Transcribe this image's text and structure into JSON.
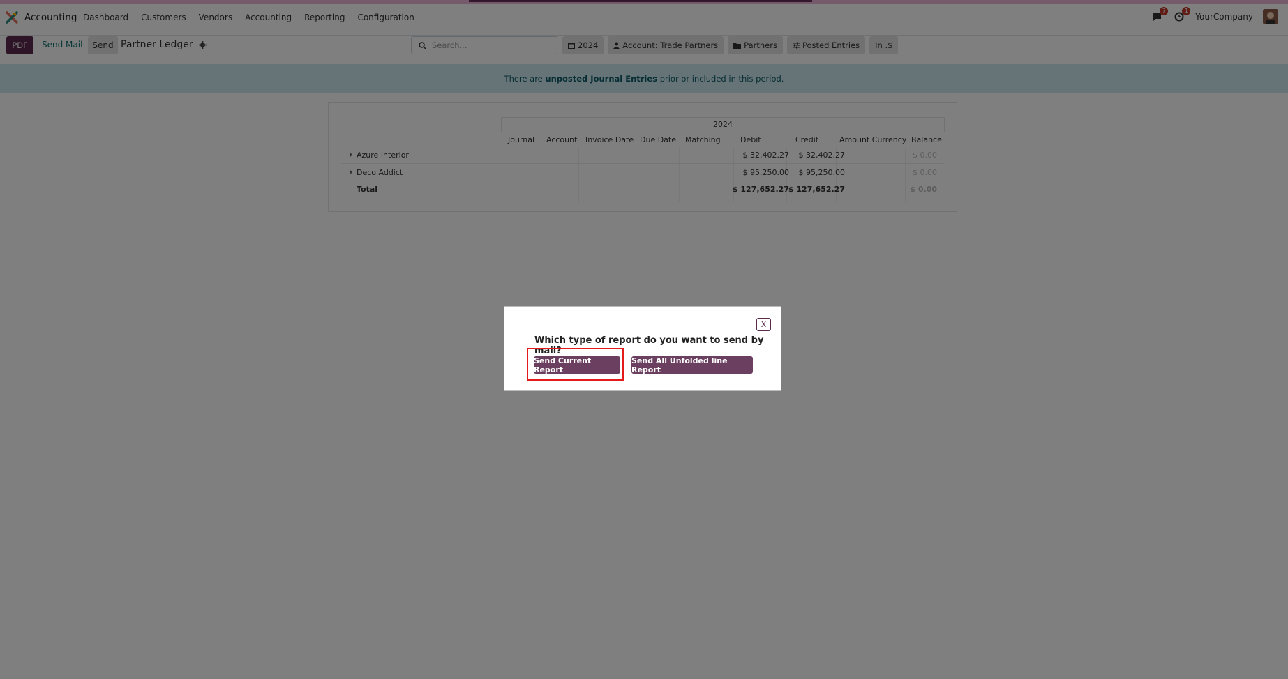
{
  "topbar": {
    "app_name": "Accounting",
    "menu": [
      "Dashboard",
      "Customers",
      "Vendors",
      "Accounting",
      "Reporting",
      "Configuration"
    ],
    "messages_count": "7",
    "activities_count": "1",
    "company": "YourCompany"
  },
  "control": {
    "pdf_label": "PDF",
    "send_mail_label": "Send Mail",
    "send_label": "Send",
    "report_title": "Partner Ledger",
    "search_placeholder": "Search...",
    "filters": [
      "2024",
      "Account: Trade Partners",
      "Partners",
      "Posted Entries",
      "In .$"
    ]
  },
  "banner": {
    "prefix": "There are ",
    "bold": "unposted Journal Entries",
    "suffix": " prior or included in this period."
  },
  "report": {
    "year": "2024",
    "columns": [
      "Journal",
      "Account",
      "Invoice Date",
      "Due Date",
      "Matching",
      "Debit",
      "Credit",
      "Amount Currency",
      "Balance"
    ],
    "rows": [
      {
        "name": "Azure Interior",
        "debit": "$ 32,402.27",
        "credit": "$ 32,402.27",
        "balance": "$ 0.00"
      },
      {
        "name": "Deco Addict",
        "debit": "$ 95,250.00",
        "credit": "$ 95,250.00",
        "balance": "$ 0.00"
      }
    ],
    "total": {
      "name": "Total",
      "debit": "$ 127,652.27",
      "credit": "$ 127,652.27",
      "balance": "$ 0.00"
    }
  },
  "modal": {
    "close_label": "X",
    "question": "Which type of report do you want to send by mail?",
    "btn_current": "Send Current Report",
    "btn_unfolded": "Send All Unfolded line Report"
  },
  "colors": {
    "brand": "#5b2b4f",
    "button": "#6b3f5f",
    "highlight": "#e31b1b",
    "banner_bg": "#cfe9ee"
  }
}
